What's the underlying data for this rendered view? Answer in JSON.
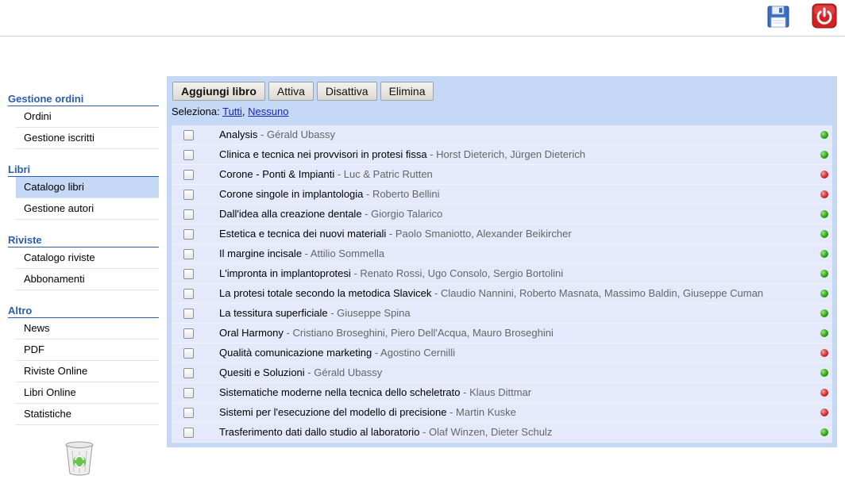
{
  "header": {
    "save_icon": "floppy-save-icon",
    "power_icon": "power-logout-icon",
    "accent_red": "#d32020"
  },
  "sidebar": {
    "sections": [
      {
        "title": "Gestione ordini",
        "items": [
          "Ordini",
          "Gestione iscritti"
        ]
      },
      {
        "title": "Libri",
        "items": [
          "Catalogo libri",
          "Gestione autori"
        ],
        "active": "Catalogo libri"
      },
      {
        "title": "Riviste",
        "items": [
          "Catalogo riviste",
          "Abbonamenti"
        ]
      },
      {
        "title": "Altro",
        "items": [
          "News",
          "PDF",
          "Riviste Online",
          "Libri Online",
          "Statistiche"
        ]
      }
    ],
    "trash_icon": "recycle-bin-icon"
  },
  "toolbar": {
    "add_label": "Aggiungi libro",
    "activate_label": "Attiva",
    "deactivate_label": "Disattiva",
    "delete_label": "Elimina"
  },
  "select": {
    "label": "Seleziona:",
    "all": "Tutti",
    "none": "Nessuno",
    "separator": ","
  },
  "books": [
    {
      "title": "Analysis",
      "authors": " - Gérald Ubassy",
      "status": "green"
    },
    {
      "title": "Clinica e tecnica nei provvisori in protesi fissa",
      "authors": " - Horst Dieterich, Jürgen Dieterich",
      "status": "green"
    },
    {
      "title": "Corone - Ponti & Impianti",
      "authors": " - Luc & Patric Rutten",
      "status": "red"
    },
    {
      "title": "Corone singole in implantologia",
      "authors": " - Roberto Bellini",
      "status": "red"
    },
    {
      "title": "Dall'idea alla creazione dentale",
      "authors": " - Giorgio Talarico",
      "status": "green"
    },
    {
      "title": "Estetica e tecnica dei nuovi materiali",
      "authors": " - Paolo Smaniotto, Alexander Beikircher",
      "status": "green"
    },
    {
      "title": "Il margine incisale",
      "authors": " - Attilio Sommella",
      "status": "green"
    },
    {
      "title": "L'impronta in implantoprotesi",
      "authors": " - Renato Rossi, Ugo Consolo, Sergio Bortolini",
      "status": "green"
    },
    {
      "title": "La protesi totale secondo la metodica Slavicek",
      "authors": " - Claudio Nannini, Roberto Masnata, Massimo Baldin, Giuseppe Cuman",
      "status": "green"
    },
    {
      "title": "La tessitura superficiale",
      "authors": " - Giuseppe Spina",
      "status": "green"
    },
    {
      "title": "Oral Harmony",
      "authors": " - Cristiano Broseghini, Piero Dell'Acqua, Mauro Broseghini",
      "status": "green"
    },
    {
      "title": "Qualità comunicazione marketing",
      "authors": " - Agostino Cernilli",
      "status": "red"
    },
    {
      "title": "Quesiti e Soluzioni",
      "authors": " - Gérald Ubassy",
      "status": "green"
    },
    {
      "title": "Sistematiche moderne nella tecnica dello scheletrato",
      "authors": " - Klaus Dittmar",
      "status": "red"
    },
    {
      "title": "Sistemi per l'esecuzione del modello di precisione",
      "authors": " - Martin Kuske",
      "status": "red"
    },
    {
      "title": "Trasferimento dati dallo studio al laboratorio",
      "authors": " - Olaf Winzen, Dieter Schulz",
      "status": "green"
    }
  ]
}
